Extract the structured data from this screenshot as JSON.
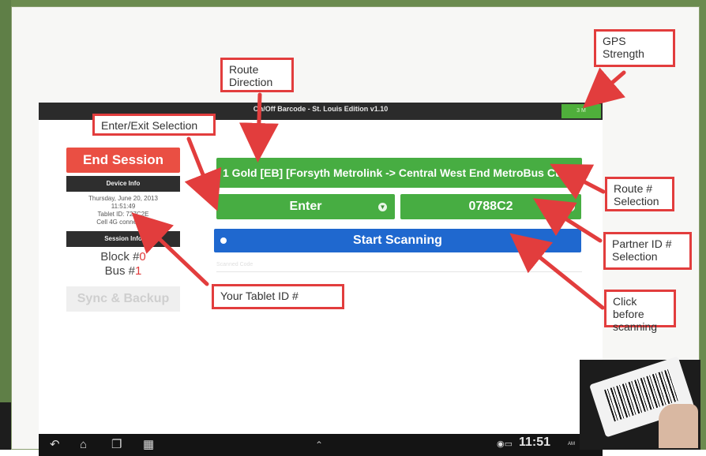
{
  "app": {
    "title": "On/Off Barcode - St. Louis Edition v1.10",
    "gps_badge": "3 M"
  },
  "left_panel": {
    "end_session": "End Session",
    "device_info_header": "Device Info",
    "date": "Thursday, June 20, 2013",
    "time": "11:51:49",
    "tablet_id": "Tablet ID: 727C2E",
    "connection": "Cell 4G connection",
    "session_info_header": "Session Info",
    "block_label": "Block #",
    "block_value": "0",
    "bus_label": "Bus #",
    "bus_value": "1",
    "sync_backup": "Sync & Backup"
  },
  "main": {
    "route_selection": "1 Gold [EB] [Forsyth Metrolink -> Central West End MetroBus Ctr...",
    "direction_value": "Enter",
    "partner_id": "0788C2",
    "start_scanning": "Start Scanning",
    "scanned_code_placeholder": "Scanned Code"
  },
  "navbar": {
    "clock": "11:51",
    "ampm": "AM"
  },
  "callouts": {
    "route_direction": "Route Direction",
    "enter_exit_selection": "Enter/Exit Selection",
    "gps_strength": "GPS Strength",
    "route_number_selection": "Route # Selection",
    "partner_id_selection": "Partner ID # Selection",
    "your_tablet_id": "Your Tablet ID #",
    "click_before_scanning": "Click before scanning"
  },
  "colors": {
    "callout_border": "#e23d3d",
    "green_button": "#47ad42",
    "blue_button": "#1f68cf",
    "end_session_red": "#ea4f43"
  },
  "icons": [
    "chevron-down-icon",
    "back-icon",
    "home-icon",
    "recent-apps-icon",
    "screenshot-icon",
    "up-icon",
    "wifi-icon",
    "signal-icon"
  ]
}
